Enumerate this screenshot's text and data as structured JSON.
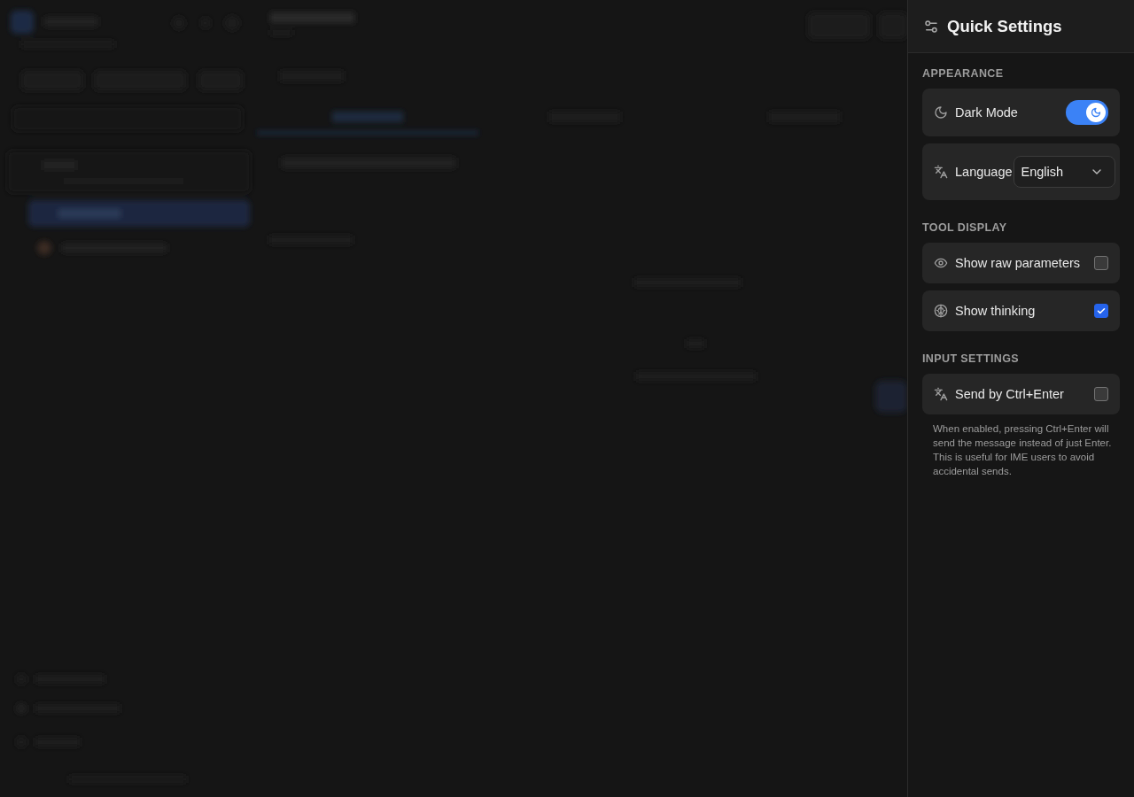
{
  "panel": {
    "title": "Quick Settings",
    "sections": [
      {
        "title": "APPEARANCE",
        "items": [
          {
            "kind": "toggle",
            "label": "Dark Mode",
            "on": true
          },
          {
            "kind": "select",
            "label": "Language",
            "value": "English"
          }
        ]
      },
      {
        "title": "TOOL DISPLAY",
        "items": [
          {
            "kind": "checkbox",
            "label": "Show raw parameters",
            "checked": false
          },
          {
            "kind": "checkbox",
            "label": "Show thinking",
            "checked": true
          }
        ]
      },
      {
        "title": "INPUT SETTINGS",
        "items": [
          {
            "kind": "checkbox",
            "label": "Send by Ctrl+Enter",
            "checked": false
          }
        ],
        "note": "When enabled, pressing Ctrl+Enter will send the message instead of just Enter. This is useful for IME users to avoid accidental sends."
      }
    ]
  }
}
